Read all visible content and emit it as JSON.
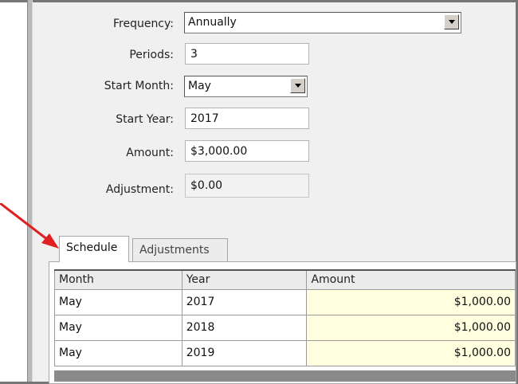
{
  "form": {
    "frequency": {
      "label": "Frequency:",
      "value": "Annually"
    },
    "periods": {
      "label": "Periods:",
      "value": "3"
    },
    "start_month": {
      "label": "Start Month:",
      "value": "May"
    },
    "start_year": {
      "label": "Start Year:",
      "value": "2017"
    },
    "amount": {
      "label": "Amount:",
      "value": "$3,000.00"
    },
    "adjustment": {
      "label": "Adjustment:",
      "value": "$0.00"
    }
  },
  "tabs": [
    {
      "label": "Schedule",
      "active": true
    },
    {
      "label": "Adjustments",
      "active": false
    }
  ],
  "grid": {
    "columns": [
      "Month",
      "Year",
      "Amount"
    ],
    "rows": [
      {
        "month": "May",
        "year": "2017",
        "amount": "$1,000.00"
      },
      {
        "month": "May",
        "year": "2018",
        "amount": "$1,000.00"
      },
      {
        "month": "May",
        "year": "2019",
        "amount": "$1,000.00"
      }
    ]
  },
  "colors": {
    "arrow": "#e02020",
    "amount_cell_bg": "#ffffe0"
  }
}
